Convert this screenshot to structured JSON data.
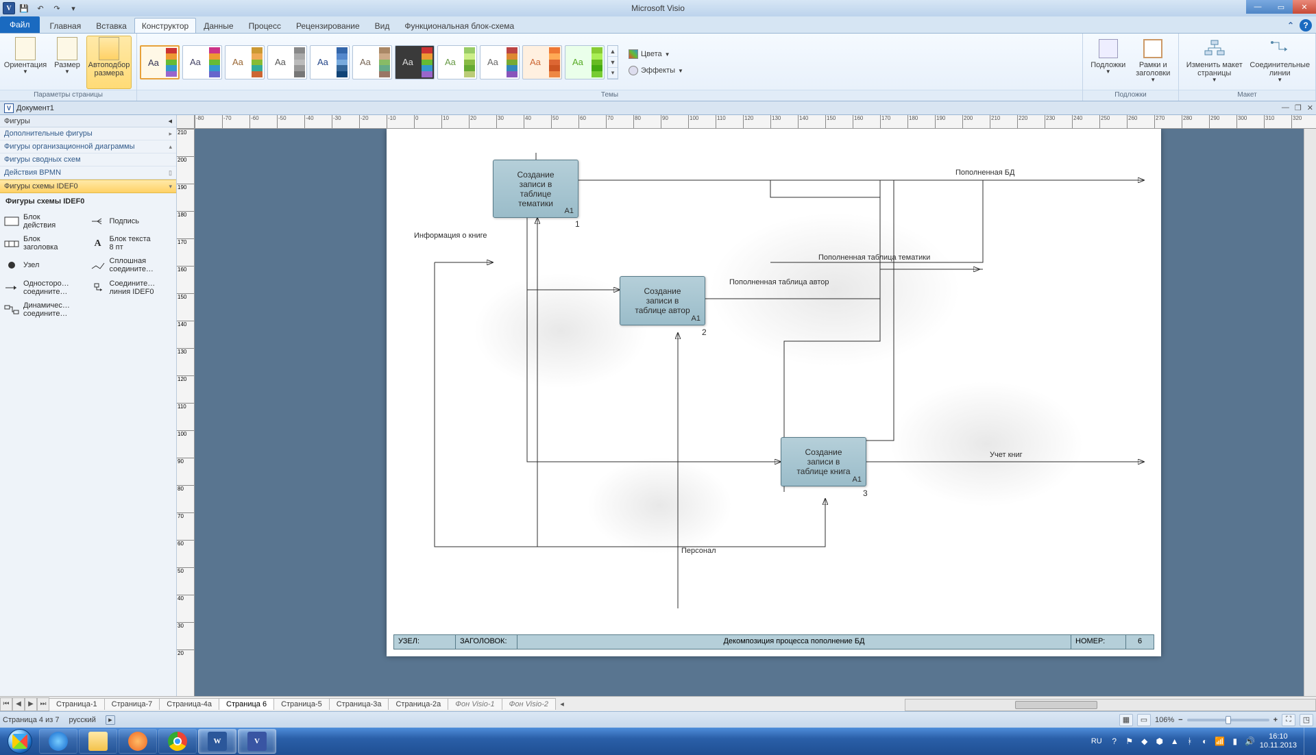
{
  "app": {
    "title": "Microsoft Visio"
  },
  "qat": {
    "save": "save-icon",
    "undo": "undo-icon",
    "redo": "redo-icon"
  },
  "ribbon": {
    "file": "Файл",
    "tabs": [
      {
        "label": "Главная"
      },
      {
        "label": "Вставка"
      },
      {
        "label": "Конструктор",
        "active": true
      },
      {
        "label": "Данные"
      },
      {
        "label": "Процесс"
      },
      {
        "label": "Рецензирование"
      },
      {
        "label": "Вид"
      },
      {
        "label": "Функциональная блок-схема"
      }
    ],
    "page_group": {
      "label": "Параметры страницы",
      "orient": "Ориентация",
      "size": "Размер",
      "autofit": "Автоподбор\nразмера"
    },
    "themes_group": {
      "label": "Темы",
      "colors": "Цвета",
      "effects": "Эффекты"
    },
    "bg_group": {
      "label": "Подложки",
      "backdrops": "Подложки",
      "frames": "Рамки и\nзаголовки"
    },
    "layout_group": {
      "label": "Макет",
      "relayout": "Изменить макет\nстраницы",
      "connectors": "Соединительные\nлинии"
    }
  },
  "doc": {
    "name": "Документ1"
  },
  "shapes_pane": {
    "header": "Фигуры",
    "rows": [
      {
        "label": "Дополнительные фигуры"
      },
      {
        "label": "Фигуры организационной диаграммы"
      },
      {
        "label": "Фигуры сводных схем"
      },
      {
        "label": "Действия BPMN"
      },
      {
        "label": "Фигуры схемы IDEF0",
        "active": true
      }
    ],
    "section_title": "Фигуры схемы IDEF0",
    "items": [
      {
        "name": "Блок\nдействия"
      },
      {
        "name": "Подпись"
      },
      {
        "name": "Блок\nзаголовка"
      },
      {
        "name": "Блок текста\n8 пт"
      },
      {
        "name": "Узел"
      },
      {
        "name": "Сплошная\nсоедините…"
      },
      {
        "name": "Односторо…\nсоедините…"
      },
      {
        "name": "Соедините…\nлиния IDEF0"
      },
      {
        "name": "Динамичес…\nсоедините…"
      }
    ]
  },
  "diagram": {
    "box1": {
      "text": "Создание\nзаписи в\nтаблице\nтематики",
      "code": "A1",
      "num": "1"
    },
    "box2": {
      "text": "Создание\nзаписи в\nтаблице автор",
      "code": "A1",
      "num": "2"
    },
    "box3": {
      "text": "Создание\nзаписи в\nтаблице книга",
      "code": "A1",
      "num": "3"
    },
    "lbl_info": "Информация о книге",
    "lbl_bd": "Пополненная БД",
    "lbl_tema": "Пополненная таблица тематики",
    "lbl_author": "Пополненная таблица автор",
    "lbl_uchet": "Учет книг",
    "lbl_personal": "Персонал",
    "title_block": {
      "uzel": "УЗЕЛ:",
      "zag": "ЗАГОЛОВОК:",
      "title": "Декомпозиция процесса пополнение БД",
      "num_lbl": "НОМЕР:",
      "num": "6"
    }
  },
  "page_tabs": [
    {
      "label": "Страница-1"
    },
    {
      "label": "Страница-7"
    },
    {
      "label": "Страница-4a"
    },
    {
      "label": "Страница 6",
      "active": true
    },
    {
      "label": "Страница-5"
    },
    {
      "label": "Страница-3a"
    },
    {
      "label": "Страница-2a"
    },
    {
      "label": "Фон Visio-1",
      "italic": true
    },
    {
      "label": "Фон Visio-2",
      "italic": true
    }
  ],
  "status": {
    "page": "Страница 4 из 7",
    "lang": "русский",
    "zoom": "106%"
  },
  "tray": {
    "lang": "RU",
    "time": "16:10",
    "date": "10.11.2013"
  }
}
